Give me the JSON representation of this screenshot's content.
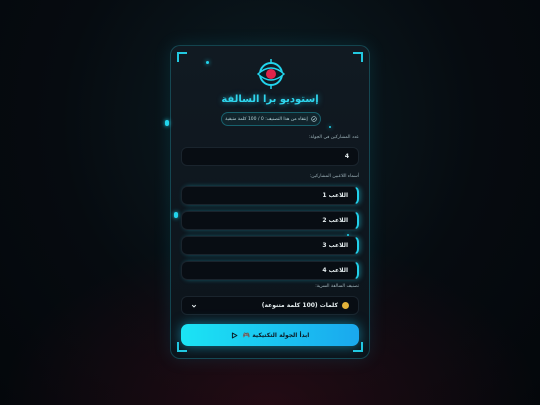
{
  "app": {
    "title": "إستوديو برا السالفة"
  },
  "badge": {
    "text": "إنتقاء من هذا التصنيف: 0 / 100 كلمة متبقية",
    "icon": "check-circle-icon"
  },
  "players_count": {
    "label": "عدد المشاركين في الجولة:",
    "value": "4"
  },
  "players": {
    "label": "أسماء اللاعبين المشاركين:",
    "items": [
      {
        "name": "اللاعب 1"
      },
      {
        "name": "اللاعب 2"
      },
      {
        "name": "اللاعب 3"
      },
      {
        "name": "اللاعب 4"
      }
    ]
  },
  "category": {
    "label": "تصنيف السالفة السرية:",
    "selected": "كلمات (100 كلمة متنوعة)",
    "icon": "coin-icon"
  },
  "start_button": {
    "label": "ابدأ الجولة التكتيكية 🎮",
    "icon": "play-icon"
  },
  "colors": {
    "accent": "#22d4ec",
    "background": "#060b10",
    "card": "#0f171f",
    "eye_red": "#e0244a"
  }
}
